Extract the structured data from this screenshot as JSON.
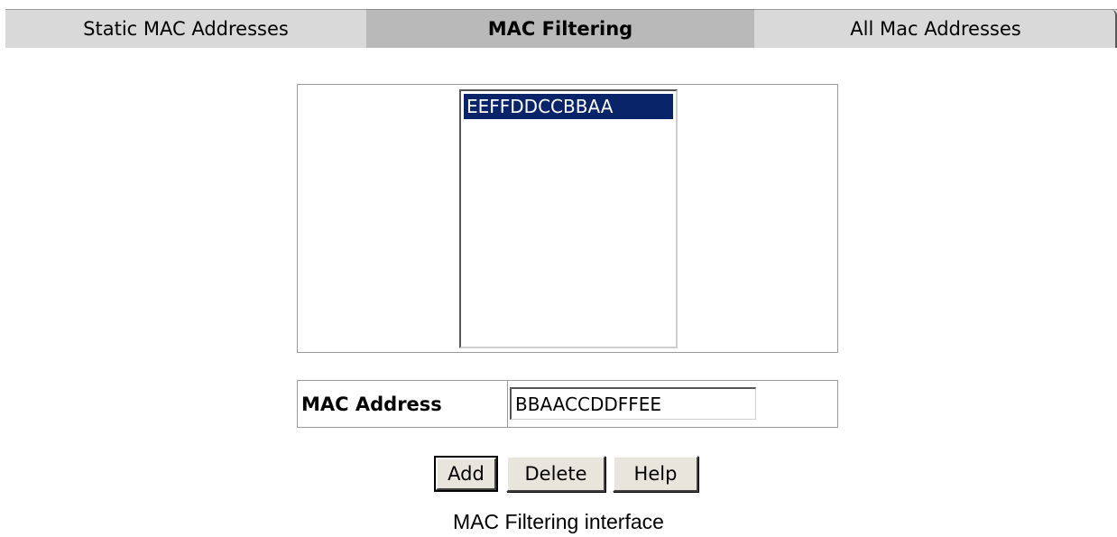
{
  "tabs": [
    {
      "label": "Static MAC Addresses",
      "active": false
    },
    {
      "label": "MAC Filtering",
      "active": true
    },
    {
      "label": "All Mac Addresses",
      "active": false
    }
  ],
  "filter_list": {
    "items": [
      "EEFFDDCCBBAA"
    ],
    "selected": "EEFFDDCCBBAA"
  },
  "form": {
    "mac_label": "MAC Address",
    "mac_value": "BBAACCDDFFEE"
  },
  "buttons": {
    "add": "Add",
    "delete": "Delete",
    "help": "Help"
  },
  "caption": "MAC Filtering interface",
  "colors": {
    "tab_inactive": "#d9d9d9",
    "tab_active": "#b9b9b9",
    "selection": "#0a246a"
  }
}
